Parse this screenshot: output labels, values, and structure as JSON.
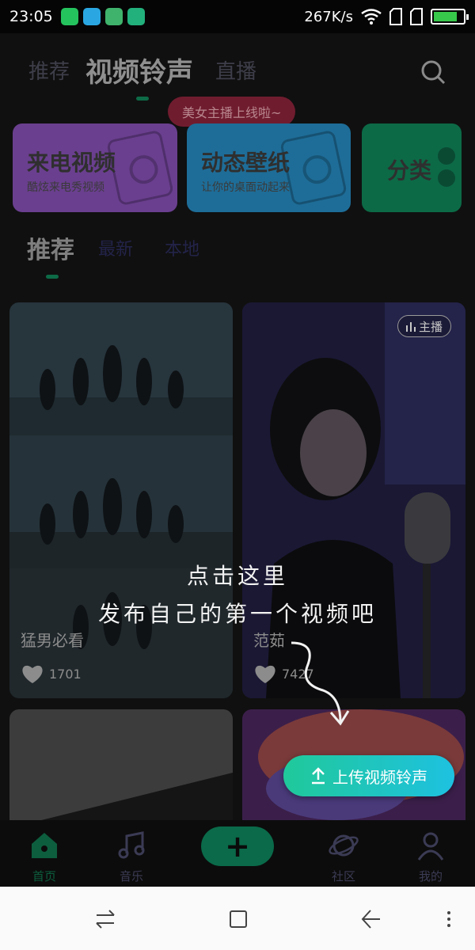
{
  "status_bar": {
    "time": "23:05",
    "speed": "267K/s",
    "battery_level": 0.8
  },
  "top_nav": {
    "tabs": [
      {
        "label": "推荐"
      },
      {
        "label": "视频铃声"
      },
      {
        "label": "直播"
      }
    ],
    "search_icon": "search-icon"
  },
  "promo_pill": "美女主播上线啦~",
  "categories": [
    {
      "title": "来电视频",
      "subtitle": "酷炫来电秀视频",
      "color": "#6a3f8f"
    },
    {
      "title": "动态壁纸",
      "subtitle": "让你的桌面动起来",
      "color": "#1e6d98"
    },
    {
      "title": "分类",
      "subtitle": "",
      "color": "#0c6a47"
    }
  ],
  "sub_tabs": [
    {
      "label": "推荐"
    },
    {
      "label": "最新"
    },
    {
      "label": "本地"
    }
  ],
  "videos": [
    {
      "name": "猛男必看",
      "likes": "1701"
    },
    {
      "name": "范茹",
      "likes": "7427",
      "badge": "主播"
    }
  ],
  "tip": {
    "line1": "点击这里",
    "line2": "发布自己的第一个视频吧"
  },
  "upload_button": "上传视频铃声",
  "bottom_nav": [
    {
      "label": "首页",
      "icon": "home-icon"
    },
    {
      "label": "音乐",
      "icon": "music-note-icon"
    },
    {
      "label": "社区",
      "icon": "planet-icon"
    },
    {
      "label": "我的",
      "icon": "person-icon"
    }
  ],
  "system_nav": [
    "switch-icon",
    "square-icon",
    "back-icon",
    "menu-icon"
  ]
}
